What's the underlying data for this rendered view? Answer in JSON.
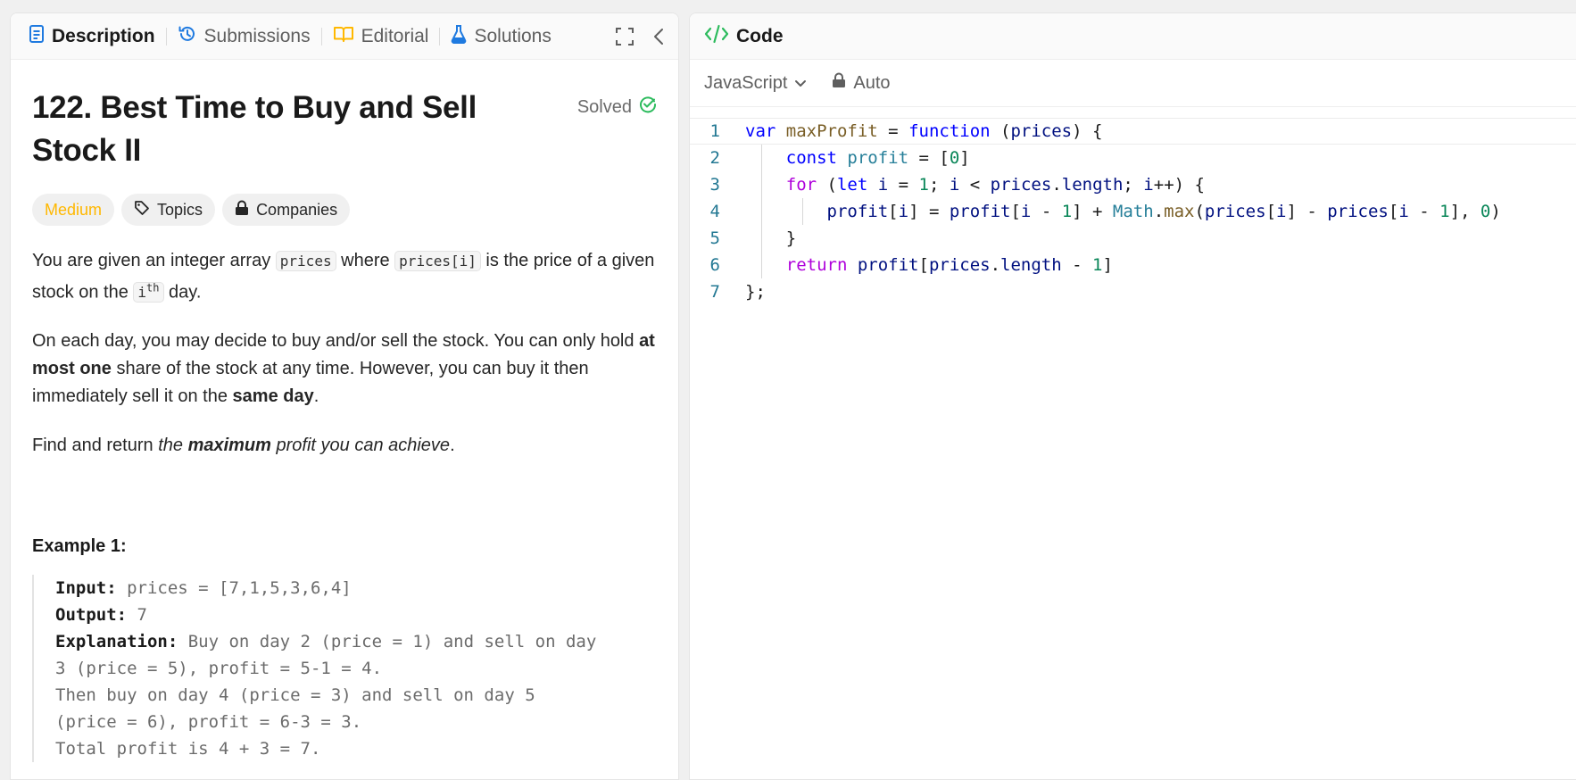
{
  "tabs": {
    "description": "Description",
    "submissions": "Submissions",
    "editorial": "Editorial",
    "solutions": "Solutions"
  },
  "problem": {
    "title": "122. Best Time to Buy and Sell Stock II",
    "status": "Solved",
    "difficulty": "Medium",
    "topics": "Topics",
    "companies": "Companies",
    "p1": {
      "t1": "You are given an integer array ",
      "c1": "prices",
      "t2": " where ",
      "c2": "prices[i]",
      "t3": " is the price of a given stock on the ",
      "c3_base": "i",
      "c3_sup": "th",
      "t4": " day."
    },
    "p2": {
      "t1": "On each day, you may decide to buy and/or sell the stock. You can only hold ",
      "b1": "at most one",
      "t2": " share of the stock at any time. However, you can buy it then immediately sell it on the ",
      "b2": "same day",
      "t3": "."
    },
    "p3": {
      "t1": "Find and return ",
      "i1": "the ",
      "bi": "maximum",
      "i2": " profit you can achieve",
      "t2": "."
    },
    "example1": {
      "title": "Example 1:",
      "input_label": "Input:",
      "input_value": " prices = [7,1,5,3,6,4]",
      "output_label": "Output:",
      "output_value": " 7",
      "explanation_label": "Explanation:",
      "explanation_lines": [
        " Buy on day 2 (price = 1) and sell on day",
        "3 (price = 5), profit = 5-1 = 4.",
        "Then buy on day 4 (price = 3) and sell on day 5",
        "(price = 6), profit = 6-3 = 3.",
        "Total profit is 4 + 3 = 7."
      ]
    }
  },
  "code_panel": {
    "title": "Code",
    "language": "JavaScript",
    "mode": "Auto",
    "line_numbers": [
      "1",
      "2",
      "3",
      "4",
      "5",
      "6",
      "7"
    ],
    "lines": [
      "var maxProfit = function (prices) {",
      "    const profit = [0]",
      "    for (let i = 1; i < prices.length; i++) {",
      "        profit[i] = profit[i - 1] + Math.max(prices[i] - prices[i - 1], 0)",
      "    }",
      "    return profit[prices.length - 1]",
      "};"
    ]
  },
  "colors": {
    "accent_blue": "#1f7ae0",
    "solved_green": "#2cbb5d",
    "medium_yellow": "#ffb800",
    "code_icon_green": "#2cbb5d"
  },
  "icons": [
    "description-icon",
    "history-icon",
    "book-icon",
    "flask-icon",
    "expand-icon",
    "chevron-left-icon",
    "code-icon",
    "chevron-down-icon",
    "lock-icon",
    "check-circle-icon",
    "tag-icon"
  ]
}
